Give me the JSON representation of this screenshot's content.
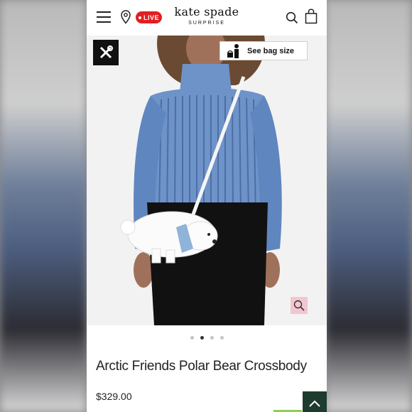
{
  "header": {
    "live_label": "LIVE",
    "logo_main": "kate spade",
    "logo_sub": "SURPRISE",
    "icons": [
      "menu-icon",
      "location-pin-icon",
      "search-icon",
      "shopping-bag-icon"
    ]
  },
  "hero": {
    "bag_size_label": "See bag size",
    "icons": [
      "tools-icon",
      "person-with-bag-icon",
      "zoom-icon"
    ],
    "image_count": 4,
    "active_image": 2
  },
  "product": {
    "title": "Arctic Friends Polar Bear Crossbody",
    "price": "$329.00"
  },
  "colors": {
    "live_red": "#e02020",
    "zoom_pink": "#f3c6cf",
    "scroll_button_green": "#1d3b2f",
    "sweater_blue": "#6d93c9"
  }
}
